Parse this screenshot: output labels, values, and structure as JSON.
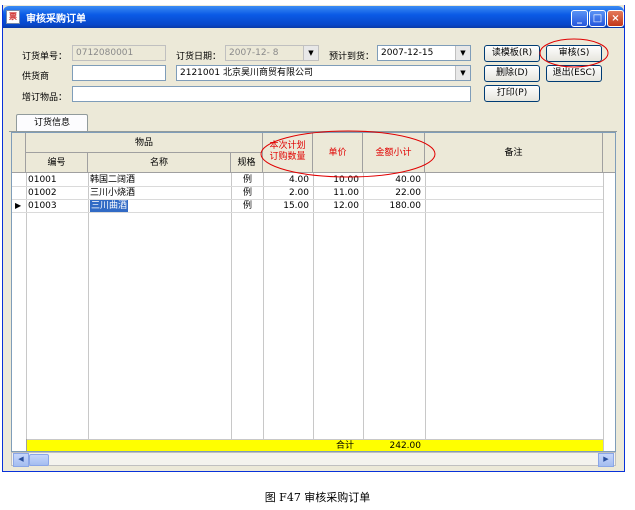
{
  "window": {
    "title": "审核采购订单",
    "icon": "app-icon"
  },
  "titlebar_buttons": {
    "minimize": "_",
    "maximize": "□",
    "close": "×"
  },
  "form": {
    "order_no_label": "订货单号：",
    "order_no": "0712080001",
    "order_date_label": "订货日期：",
    "order_date": "2007-12- 8",
    "arrival_label": "预计到货：",
    "arrival": "2007-12-15",
    "supplier_label": "供货商",
    "supplier_code": "",
    "supplier_name": "2121001 北京昊川商贸有限公司",
    "add_item_label": "增订物品：",
    "add_item": ""
  },
  "buttons": {
    "read_template": "读模板(R)",
    "approve": "审核(S)",
    "delete": "删除(D)",
    "exit": "退出(ESC)",
    "print": "打印(P)"
  },
  "tab": {
    "label": "订货信息"
  },
  "grid": {
    "group_header": "物品",
    "headers": {
      "code": "编号",
      "name": "名称",
      "spec": "规格",
      "qty_line1": "本次计划",
      "qty_line2": "订购数量",
      "price": "单价",
      "subtotal": "金额小计",
      "note": "备注"
    },
    "rows": [
      {
        "code": "01001",
        "name": "韩国二阔酒",
        "spec": "例",
        "qty": "4.00",
        "price": "10.00",
        "subtotal": "40.00",
        "note": ""
      },
      {
        "code": "01002",
        "name": "三川小烧酒",
        "spec": "例",
        "qty": "2.00",
        "price": "11.00",
        "subtotal": "22.00",
        "note": ""
      },
      {
        "code": "01003",
        "name": "三川曲酒",
        "spec": "例",
        "qty": "15.00",
        "price": "12.00",
        "subtotal": "180.00",
        "note": ""
      }
    ],
    "total_label": "合计",
    "total_value": "242.00",
    "highlight_color": "#ffff00"
  },
  "scrollbar": {
    "left": "◀",
    "right": "▶"
  },
  "caption": "图 F47  审核采购订单"
}
